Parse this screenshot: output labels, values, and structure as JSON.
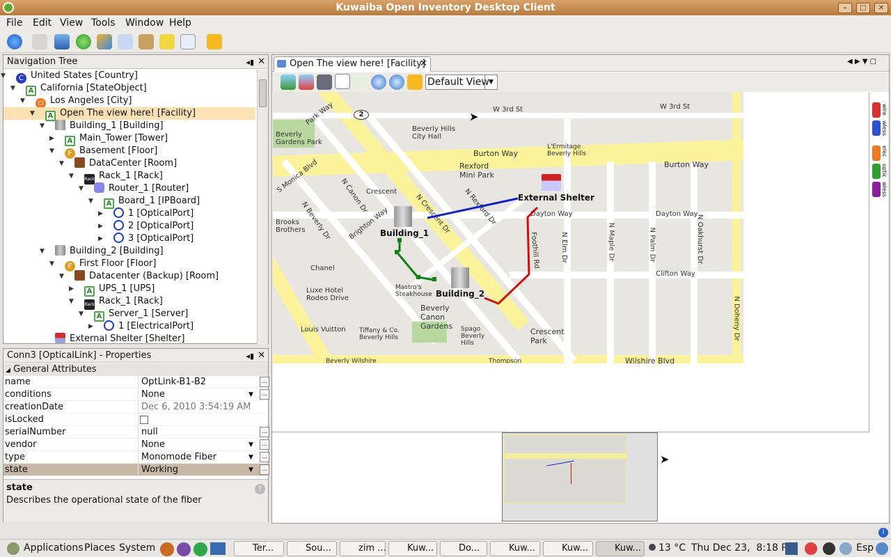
{
  "window": {
    "title": "Kuwaiba Open Inventory Desktop Client"
  },
  "menu": [
    "File",
    "Edit",
    "View",
    "Tools",
    "Window",
    "Help"
  ],
  "nav": {
    "title": "Navigation Tree",
    "items": [
      {
        "label": "United States [Country]",
        "icon": "C"
      },
      {
        "label": "California [StateObject]",
        "icon": "A"
      },
      {
        "label": "Los Angeles [City]",
        "icon": "Ci"
      },
      {
        "label": "Open The view here! [Facility]",
        "icon": "A"
      },
      {
        "label": "Building_1 [Building]",
        "icon": "bld"
      },
      {
        "label": "Main_Tower [Tower]",
        "icon": "A"
      },
      {
        "label": "Basement [Floor]",
        "icon": "F"
      },
      {
        "label": "DataCenter [Room]",
        "icon": "room"
      },
      {
        "label": "Rack_1 [Rack]",
        "icon": "Rack"
      },
      {
        "label": "Router_1 [Router]",
        "icon": "router"
      },
      {
        "label": "Board_1 [IPBoard]",
        "icon": "A"
      },
      {
        "label": "1 [OpticalPort]",
        "icon": "port"
      },
      {
        "label": "2 [OpticalPort]",
        "icon": "port"
      },
      {
        "label": "3 [OpticalPort]",
        "icon": "port"
      },
      {
        "label": "Building_2 [Building]",
        "icon": "bld"
      },
      {
        "label": "First Floor [Floor]",
        "icon": "F"
      },
      {
        "label": "Datacenter (Backup) [Room]",
        "icon": "room"
      },
      {
        "label": "UPS_1 [UPS]",
        "icon": "A"
      },
      {
        "label": "Rack_1 [Rack]",
        "icon": "Rack"
      },
      {
        "label": "Server_1 [Server]",
        "icon": "A"
      },
      {
        "label": "1 [ElectricalPort]",
        "icon": "port"
      },
      {
        "label": "External Shelter [Shelter]",
        "icon": "shelter"
      }
    ]
  },
  "props": {
    "title": "Conn3 [OpticalLink] - Properties",
    "section": "General Attributes",
    "rows": [
      {
        "k": "name",
        "v": "OptLink-B1-B2"
      },
      {
        "k": "conditions",
        "v": "None"
      },
      {
        "k": "creationDate",
        "v": "Dec 6, 2010 3:54:19 AM"
      },
      {
        "k": "isLocked",
        "v": ""
      },
      {
        "k": "serialNumber",
        "v": "null"
      },
      {
        "k": "vendor",
        "v": "None"
      },
      {
        "k": "type",
        "v": "Monomode Fiber"
      },
      {
        "k": "state",
        "v": "Working"
      }
    ],
    "desc_title": "state",
    "desc_text": "Describes the operational state of the fiber"
  },
  "view": {
    "tab": "Open The view here! [Facility]",
    "dropdown": "Default View",
    "nodes": {
      "b1": "Building_1",
      "b2": "Building_2",
      "shelter": "External Shelter"
    },
    "streets": [
      "W 3rd St",
      "W 3rd St",
      "Burton Way",
      "Burton Way",
      "Dayton Way",
      "Dayton Way",
      "Clifton Way",
      "Wilshire Blvd",
      "N Crescent Dr",
      "N Rexford Dr",
      "N Beverly Dr",
      "N Canon Dr",
      "N Elm Dr",
      "N Maple Dr",
      "N Palm Dr",
      "N Oakhurst Dr",
      "N Doheny Dr",
      "Brighton Way",
      "Park Way",
      "Beverly Gardens Park",
      "Beverly Hills City Hall",
      "Rexford Mini Park",
      "L'Ermitage Beverly Hills",
      "Beverly Canon Gardens",
      "Crescent Park",
      "Chanel",
      "Luxe Hotel Rodeo Drive",
      "Mastro's Steakhouse",
      "Louis Vuitton",
      "Tiffany & Co. Beverly Hills",
      "Spago Beverly Hills",
      "Brooks Brothers",
      "Beverly Wilshire",
      "Thompson",
      "Crescent",
      "Foothill Rd",
      "S Monica Blvd"
    ],
    "legend": [
      "wire",
      "wless",
      "elec",
      "optic",
      "wless"
    ]
  },
  "taskbar": {
    "apps": [
      "Applications",
      "Places",
      "System"
    ],
    "tasks": [
      "Ter...",
      "Sou...",
      "zim ...",
      "Kuw...",
      "Do...",
      "Kuw...",
      "Kuw...",
      "Kuw..."
    ],
    "weather": "13 °C",
    "clock": "Thu Dec 23,  8:18 PM",
    "lang": "Esp"
  },
  "colors": {
    "accent": "#c08046",
    "blue_link": "#1020d0",
    "green_link": "#108010",
    "red_link": "#d01010",
    "hwy": "#fbf39a"
  }
}
